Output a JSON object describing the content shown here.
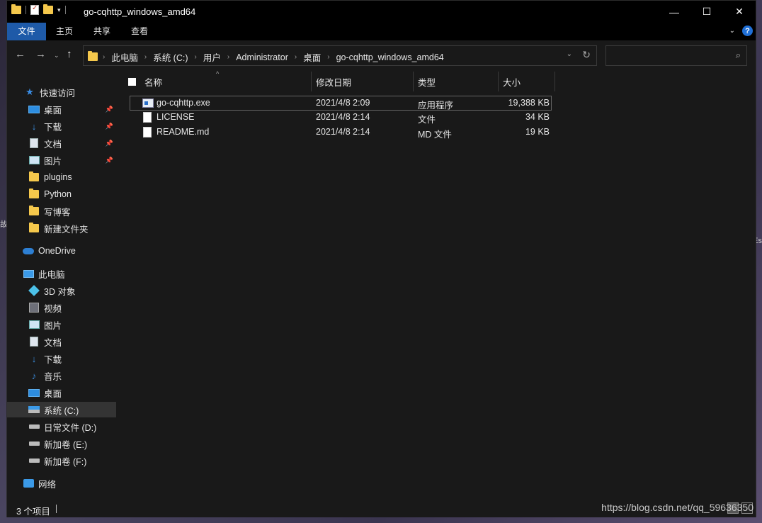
{
  "window": {
    "title": "go-cqhttp_windows_amd64"
  },
  "ribbon": {
    "tabs": [
      {
        "label": "文件",
        "active": true
      },
      {
        "label": "主页",
        "active": false
      },
      {
        "label": "共享",
        "active": false
      },
      {
        "label": "查看",
        "active": false
      }
    ],
    "help_label": "?"
  },
  "address": {
    "crumbs": [
      "此电脑",
      "系统 (C:)",
      "用户",
      "Administrator",
      "桌面",
      "go-cqhttp_windows_amd64"
    ]
  },
  "sidebar": {
    "quick_access": "快速访问",
    "quick_items": [
      {
        "label": "桌面",
        "icon": "desktop-icon",
        "pinned": true
      },
      {
        "label": "下载",
        "icon": "download-icon",
        "pinned": true
      },
      {
        "label": "文档",
        "icon": "document-icon",
        "pinned": true
      },
      {
        "label": "图片",
        "icon": "picture-icon",
        "pinned": true
      },
      {
        "label": "plugins",
        "icon": "folder-icon",
        "pinned": false
      },
      {
        "label": "Python",
        "icon": "folder-icon",
        "pinned": false
      },
      {
        "label": "写博客",
        "icon": "folder-icon",
        "pinned": false
      },
      {
        "label": "新建文件夹",
        "icon": "folder-icon",
        "pinned": false
      }
    ],
    "onedrive": "OneDrive",
    "this_pc": "此电脑",
    "pc_items": [
      {
        "label": "3D 对象",
        "icon": "3d-objects-icon"
      },
      {
        "label": "视频",
        "icon": "video-icon"
      },
      {
        "label": "图片",
        "icon": "picture-icon"
      },
      {
        "label": "文档",
        "icon": "document-icon"
      },
      {
        "label": "下载",
        "icon": "download-icon"
      },
      {
        "label": "音乐",
        "icon": "music-icon"
      },
      {
        "label": "桌面",
        "icon": "desktop-icon"
      },
      {
        "label": "系统 (C:)",
        "icon": "system-drive-icon",
        "selected": true
      },
      {
        "label": "日常文件 (D:)",
        "icon": "drive-icon"
      },
      {
        "label": "新加卷 (E:)",
        "icon": "drive-icon"
      },
      {
        "label": "新加卷 (F:)",
        "icon": "drive-icon"
      }
    ],
    "network": "网络"
  },
  "columns": {
    "name": "名称",
    "modified": "修改日期",
    "type": "类型",
    "size": "大小"
  },
  "files": [
    {
      "name": "go-cqhttp.exe",
      "modified": "2021/4/8 2:09",
      "type": "应用程序",
      "size": "19,388 KB",
      "icon": "exe-icon"
    },
    {
      "name": "LICENSE",
      "modified": "2021/4/8 2:14",
      "type": "文件",
      "size": "34 KB",
      "icon": "file-icon"
    },
    {
      "name": "README.md",
      "modified": "2021/4/8 2:14",
      "type": "MD 文件",
      "size": "19 KB",
      "icon": "file-icon"
    }
  ],
  "status": {
    "count": "3 个项目"
  },
  "watermark": "https://blog.csdn.net/qq_59636350",
  "edge": {
    "left": "故",
    "right": "Es"
  }
}
